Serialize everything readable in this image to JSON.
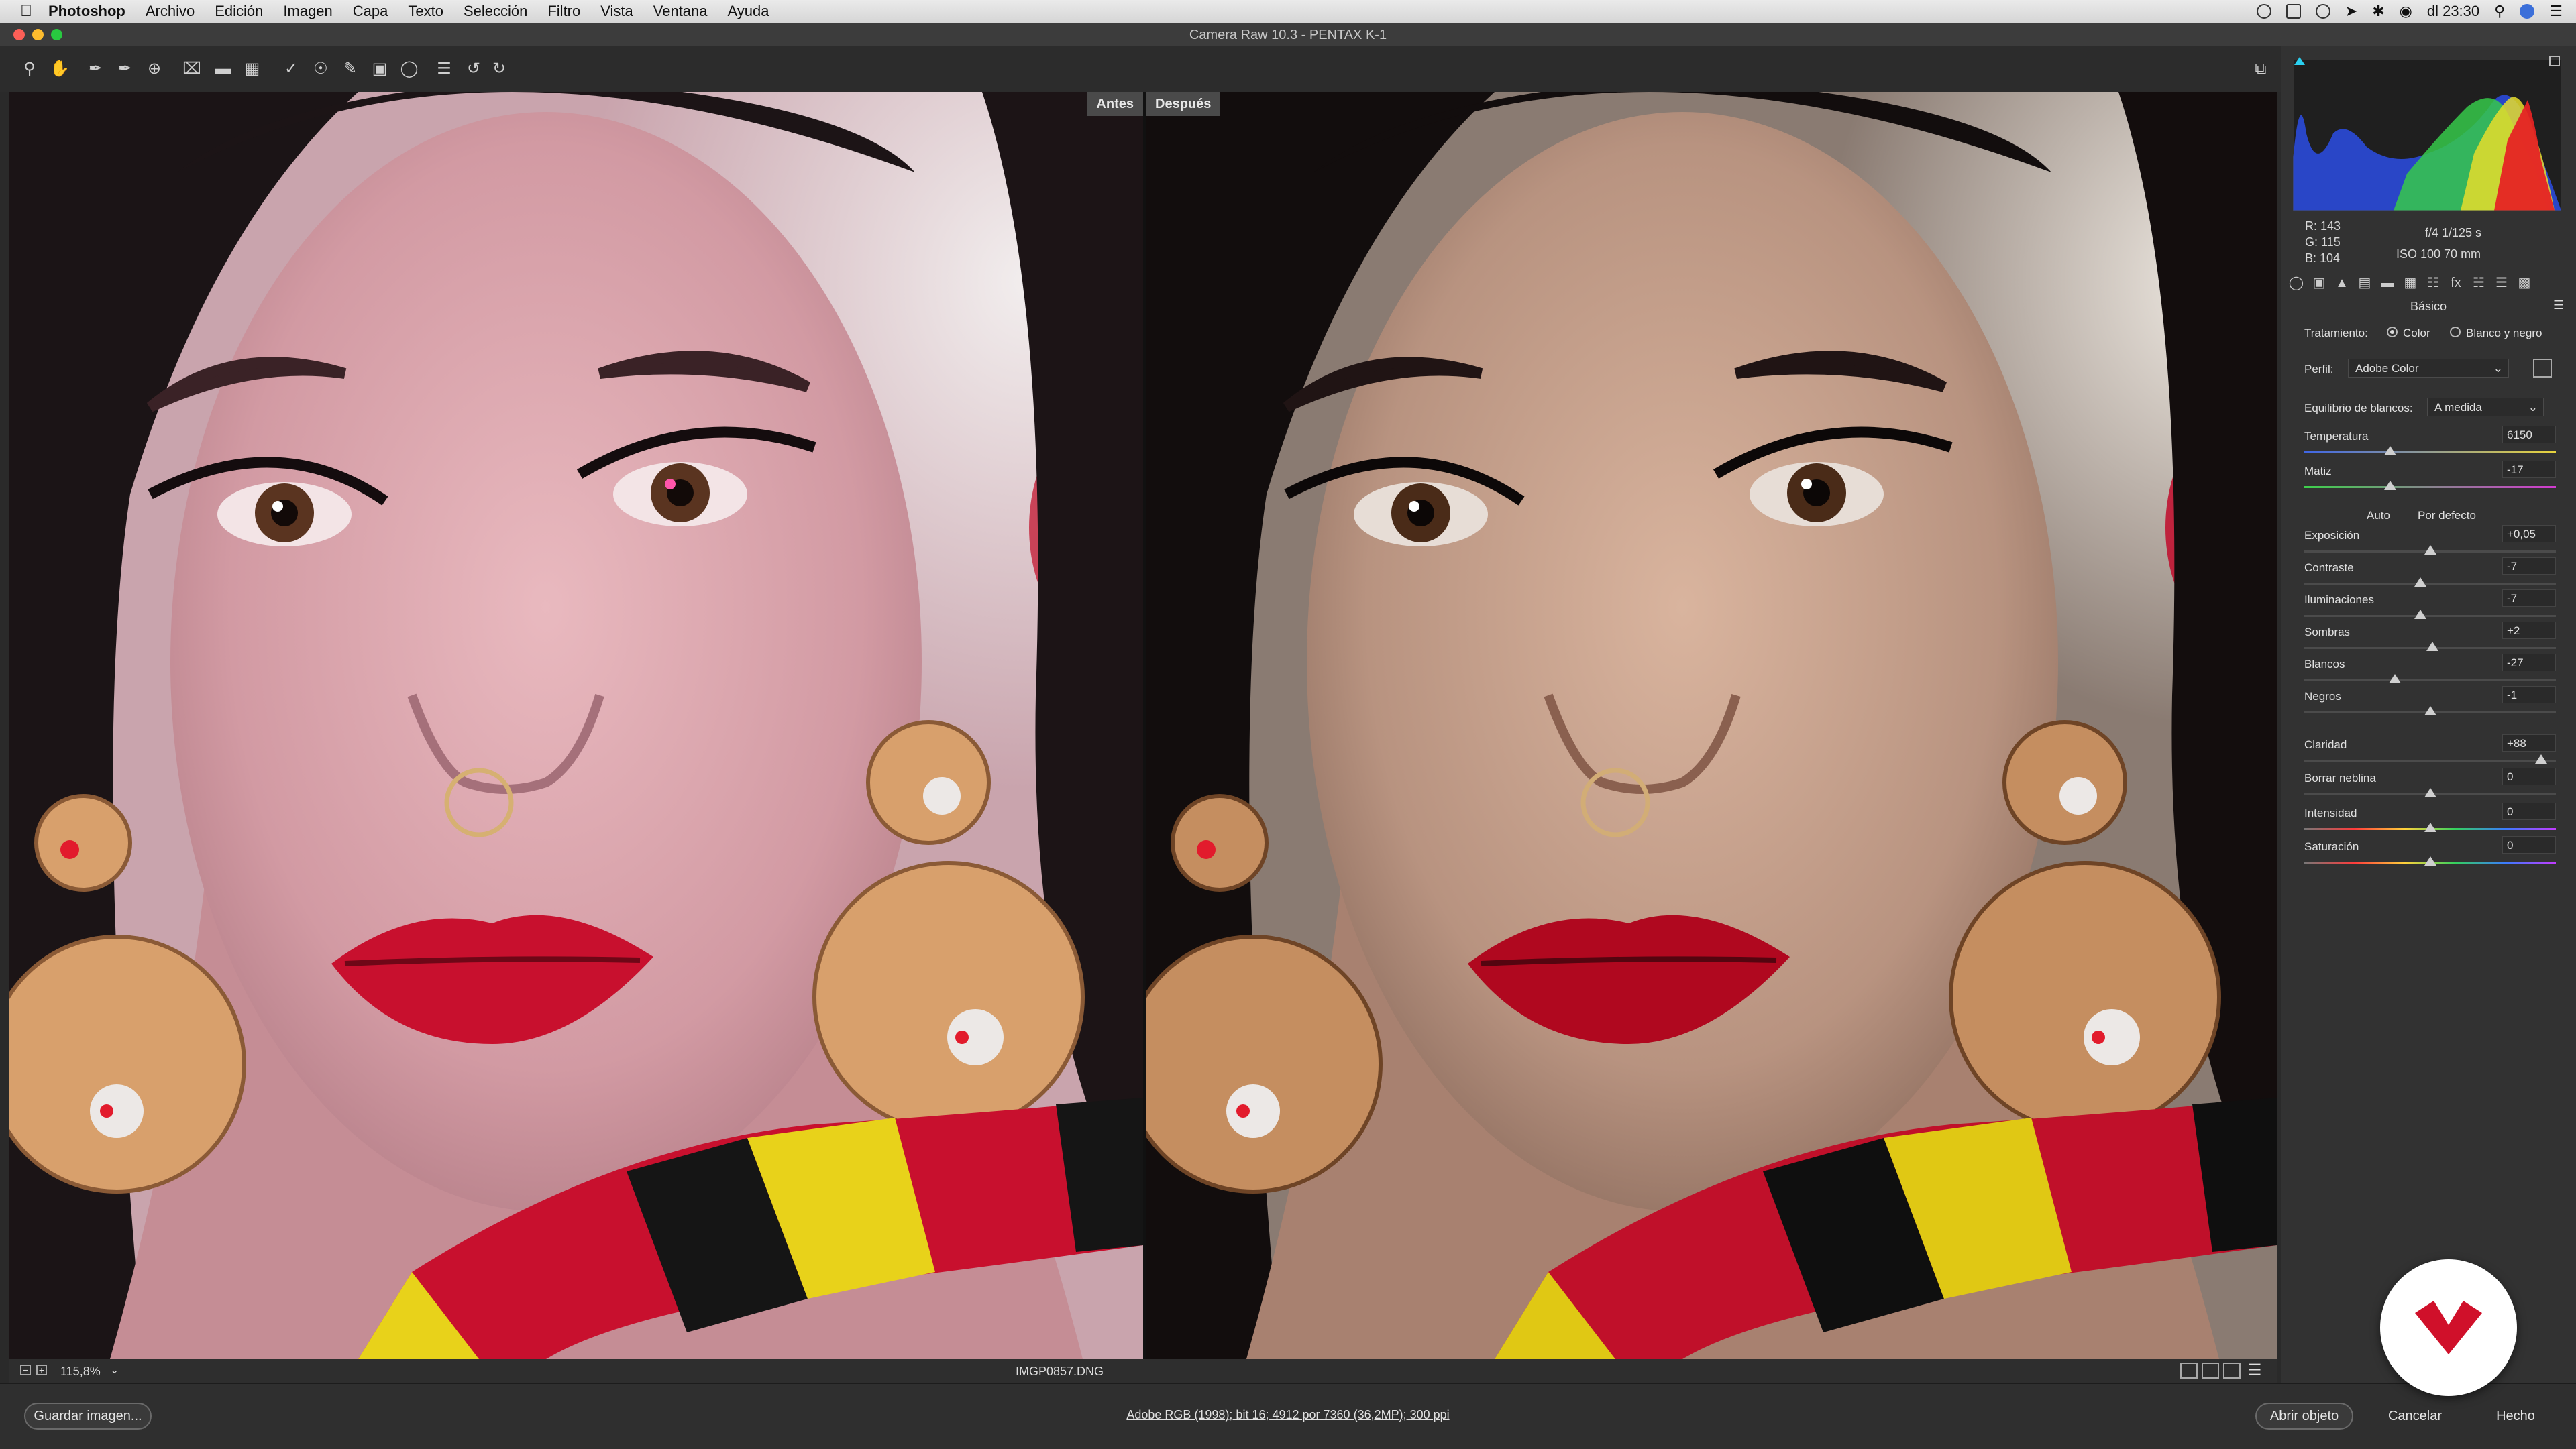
{
  "menubar": {
    "app": "Photoshop",
    "items": [
      "Archivo",
      "Edición",
      "Imagen",
      "Capa",
      "Texto",
      "Selección",
      "Filtro",
      "Vista",
      "Ventana",
      "Ayuda"
    ],
    "clock": "dl 23:30"
  },
  "window": {
    "title": "Camera Raw 10.3 -  PENTAX K-1"
  },
  "toolbar": {
    "tools": [
      "zoom-icon",
      "hand-icon",
      "white-balance-icon",
      "color-sampler-icon",
      "target-adjust-icon",
      "crop-icon",
      "straighten-icon",
      "transform-icon",
      "spot-removal-icon",
      "red-eye-icon",
      "adjustment-brush-icon",
      "graduated-filter-icon",
      "radial-filter-icon",
      "presets-list-icon",
      "rotate-left-icon",
      "rotate-right-icon"
    ]
  },
  "viewer": {
    "before_label": "Antes",
    "after_label": "Después"
  },
  "statusbar": {
    "zoom": "115,8%",
    "filename": "IMGP0857.DNG"
  },
  "footer": {
    "save_label": "Guardar imagen...",
    "workflow_info": "Adobe RGB (1998); bit 16; 4912 por 7360 (36,2MP); 300 ppi",
    "open_label": "Abrir objeto",
    "cancel_label": "Cancelar",
    "done_label": "Hecho"
  },
  "readout": {
    "r": "R:  143",
    "g": "G:  115",
    "b": "B:  104",
    "exposure": "f/4    1/125 s",
    "iso": "ISO 100    70 mm"
  },
  "panel": {
    "section": "Básico",
    "treatment_label": "Tratamiento:",
    "treatment_color": "Color",
    "treatment_bw": "Blanco y negro",
    "profile_label": "Perfil:",
    "profile_value": "Adobe Color",
    "wb_label": "Equilibrio de blancos:",
    "wb_value": "A medida",
    "auto_label": "Auto",
    "default_label": "Por defecto",
    "sliders": [
      {
        "label": "Temperatura",
        "value": "6150",
        "pos": 0.34,
        "kind": "temp"
      },
      {
        "label": "Matiz",
        "value": "-17",
        "pos": 0.34,
        "kind": "tint"
      },
      {
        "label": "Exposición",
        "value": "+0,05",
        "pos": 0.5,
        "kind": "plain"
      },
      {
        "label": "Contraste",
        "value": "-7",
        "pos": 0.46,
        "kind": "plain"
      },
      {
        "label": "Iluminaciones",
        "value": "-7",
        "pos": 0.46,
        "kind": "plain"
      },
      {
        "label": "Sombras",
        "value": "+2",
        "pos": 0.51,
        "kind": "plain"
      },
      {
        "label": "Blancos",
        "value": "-27",
        "pos": 0.36,
        "kind": "plain"
      },
      {
        "label": "Negros",
        "value": "-1",
        "pos": 0.5,
        "kind": "plain"
      },
      {
        "label": "Claridad",
        "value": "+88",
        "pos": 0.94,
        "kind": "plain"
      },
      {
        "label": "Borrar neblina",
        "value": "0",
        "pos": 0.5,
        "kind": "plain"
      },
      {
        "label": "Intensidad",
        "value": "0",
        "pos": 0.5,
        "kind": "sat"
      },
      {
        "label": "Saturación",
        "value": "0",
        "pos": 0.5,
        "kind": "sat"
      }
    ]
  },
  "colors": {
    "accent": "#3a8fd8",
    "lip_red": "#c8102e",
    "snake_yellow": "#e8d21a"
  }
}
